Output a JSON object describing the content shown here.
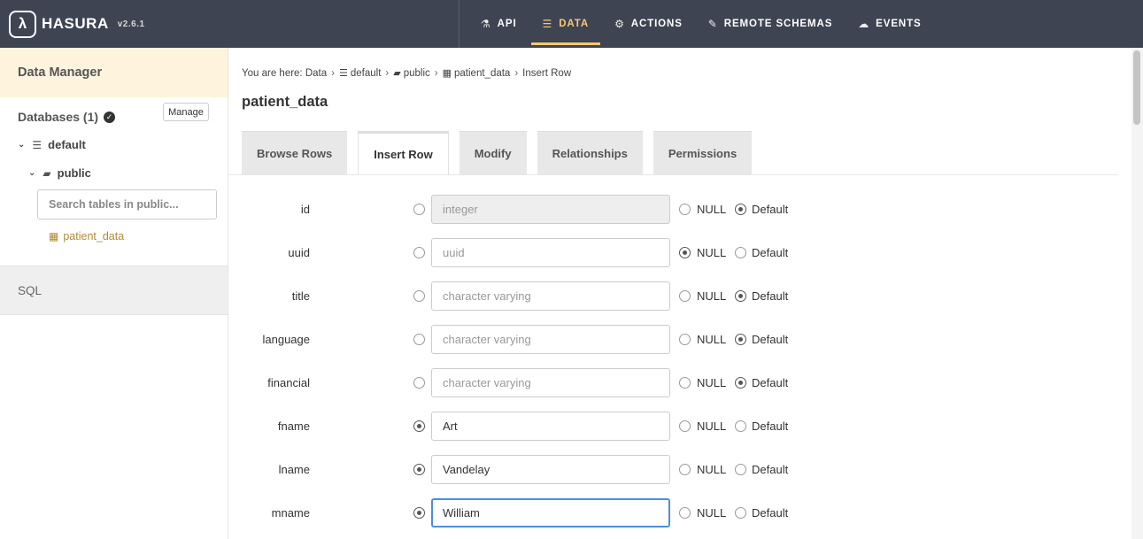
{
  "header": {
    "brand": "HASURA",
    "version": "v2.6.1",
    "nav": [
      {
        "label": "API",
        "icon": "flask-icon",
        "glyph": "⚗",
        "active": false
      },
      {
        "label": "DATA",
        "icon": "database-icon",
        "glyph": "☰",
        "active": true
      },
      {
        "label": "ACTIONS",
        "icon": "cogs-icon",
        "glyph": "⚙",
        "active": false
      },
      {
        "label": "REMOTE SCHEMAS",
        "icon": "plug-icon",
        "glyph": "✎",
        "active": false
      },
      {
        "label": "EVENTS",
        "icon": "cloud-icon",
        "glyph": "☁",
        "active": false
      }
    ]
  },
  "sidebar": {
    "title": "Data Manager",
    "databases_label": "Databases (1)",
    "manage_label": "Manage",
    "database_name": "default",
    "schema_name": "public",
    "search_placeholder": "Search tables in public...",
    "table_name": "patient_data",
    "sql_label": "SQL"
  },
  "main": {
    "breadcrumb": {
      "prefix": "You are here:",
      "data": "Data",
      "database": "default",
      "schema": "public",
      "table": "patient_data",
      "current": "Insert Row"
    },
    "title": "patient_data",
    "tabs": [
      {
        "label": "Browse Rows",
        "active": false
      },
      {
        "label": "Insert Row",
        "active": true
      },
      {
        "label": "Modify",
        "active": false
      },
      {
        "label": "Relationships",
        "active": false
      },
      {
        "label": "Permissions",
        "active": false
      }
    ],
    "null_label": "NULL",
    "default_label": "Default",
    "fields": [
      {
        "name": "id",
        "placeholder": "integer",
        "value": "",
        "selected": "default",
        "disabled": true
      },
      {
        "name": "uuid",
        "placeholder": "uuid",
        "value": "",
        "selected": "null"
      },
      {
        "name": "title",
        "placeholder": "character varying",
        "value": "",
        "selected": "default"
      },
      {
        "name": "language",
        "placeholder": "character varying",
        "value": "",
        "selected": "default"
      },
      {
        "name": "financial",
        "placeholder": "character varying",
        "value": "",
        "selected": "default"
      },
      {
        "name": "fname",
        "placeholder": "",
        "value": "Art",
        "selected": "value"
      },
      {
        "name": "lname",
        "placeholder": "",
        "value": "Vandelay",
        "selected": "value"
      },
      {
        "name": "mname",
        "placeholder": "",
        "value": "William",
        "selected": "value",
        "focused": true
      }
    ]
  },
  "colors": {
    "nav_bg": "#3e4452",
    "accent": "#f7c873",
    "sidebar_header_bg": "#fef3dc",
    "table_link": "#b08a3a",
    "focus_border": "#4b8fd8"
  }
}
